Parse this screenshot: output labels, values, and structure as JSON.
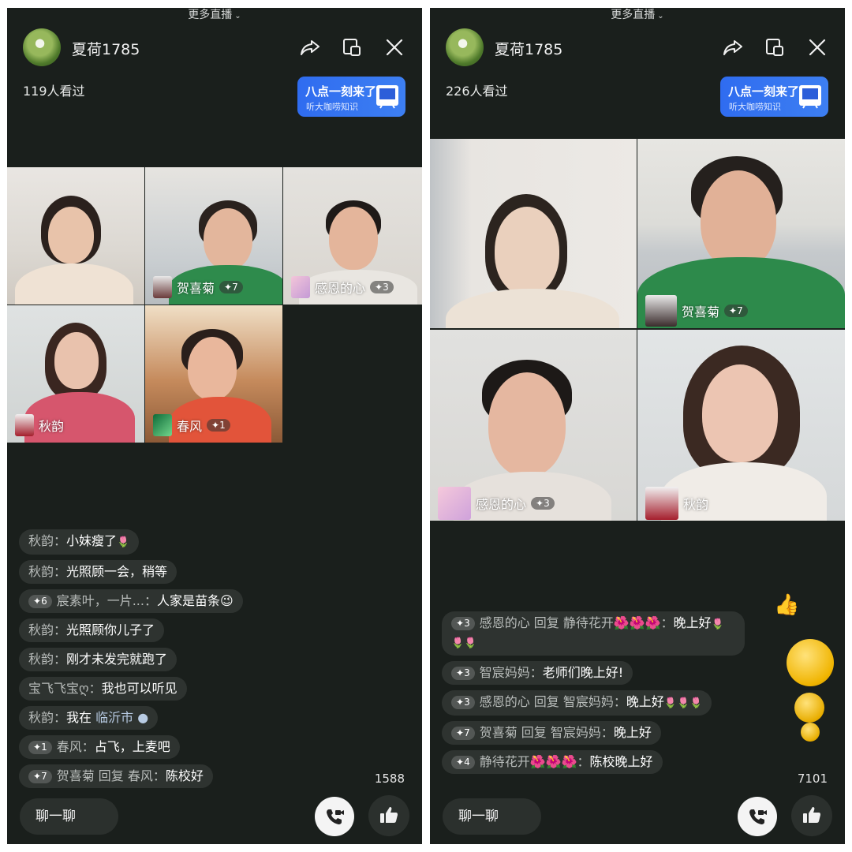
{
  "left": {
    "more_live": "更多直播",
    "host_name": "夏荷1785",
    "viewers": "119人看过",
    "promo": {
      "title": "八点一刻来了",
      "subtitle": "听大咖唠知识"
    },
    "guests": [
      {
        "name": "",
        "level": ""
      },
      {
        "name": "贺喜菊",
        "level": "7"
      },
      {
        "name": "感恩的心",
        "level": "3"
      },
      {
        "name": "秋韵",
        "level": ""
      },
      {
        "name": "春风",
        "level": "1"
      }
    ],
    "comments": [
      {
        "level": "",
        "name": "秋韵：",
        "text": "小妹瘦了",
        "flowers": "🌷"
      },
      {
        "level": "",
        "name": "秋韵：",
        "text": "光照顾一会，稍等"
      },
      {
        "level": "6",
        "name": "宸素叶，一片...：",
        "text": "人家是苗条😉"
      },
      {
        "level": "",
        "name": "秋韵：",
        "text": "光照顾你儿子了"
      },
      {
        "level": "",
        "name": "秋韵：",
        "text": "刚才未发完就跑了"
      },
      {
        "level": "",
        "name": "宝飞飞宝ღ：",
        "text": "我也可以听见"
      },
      {
        "level": "",
        "name": "秋韵：",
        "text": "我在",
        "highlight": "临沂市",
        "pin": "📍"
      },
      {
        "level": "1",
        "name": "春风：",
        "text": "占飞，上麦吧"
      },
      {
        "level": "7",
        "name": "贺喜菊 回复 春风：",
        "text": "陈校好"
      }
    ],
    "like_count": "1588",
    "chat_placeholder": "聊一聊"
  },
  "right": {
    "more_live": "更多直播",
    "host_name": "夏荷1785",
    "viewers": "226人看过",
    "promo": {
      "title": "八点一刻来了",
      "subtitle": "听大咖唠知识"
    },
    "guests": [
      {
        "name": "",
        "level": ""
      },
      {
        "name": "贺喜菊",
        "level": "7"
      },
      {
        "name": "感恩的心",
        "level": "3"
      },
      {
        "name": "秋韵",
        "level": ""
      }
    ],
    "comments": [
      {
        "level": "3",
        "name": "感恩的心 回复 静待花开🌺🌺🌺：",
        "text": "晚上好",
        "flowers": "🌷🌷🌷"
      },
      {
        "level": "3",
        "name": "智宸妈妈：",
        "text": "老师们晚上好!"
      },
      {
        "level": "3",
        "name": "感恩的心 回复 智宸妈妈：",
        "text": "晚上好",
        "flowers": "🌷🌷🌷"
      },
      {
        "level": "7",
        "name": "贺喜菊 回复 智宸妈妈：",
        "text": "晚上好"
      },
      {
        "level": "4",
        "name": "静待花开🌺🌺🌺：",
        "text": "陈校晚上好"
      }
    ],
    "like_count": "7101",
    "chat_placeholder": "聊一聊"
  },
  "icons": [
    "share-icon",
    "float-window-icon",
    "close-icon",
    "video-call-icon",
    "thumbs-up-icon",
    "location-pin-icon"
  ],
  "colors": {
    "panel_bg": "#1a1f1c",
    "promo_blue": "#2f6cf0",
    "flower_red": "#e24a5f"
  }
}
